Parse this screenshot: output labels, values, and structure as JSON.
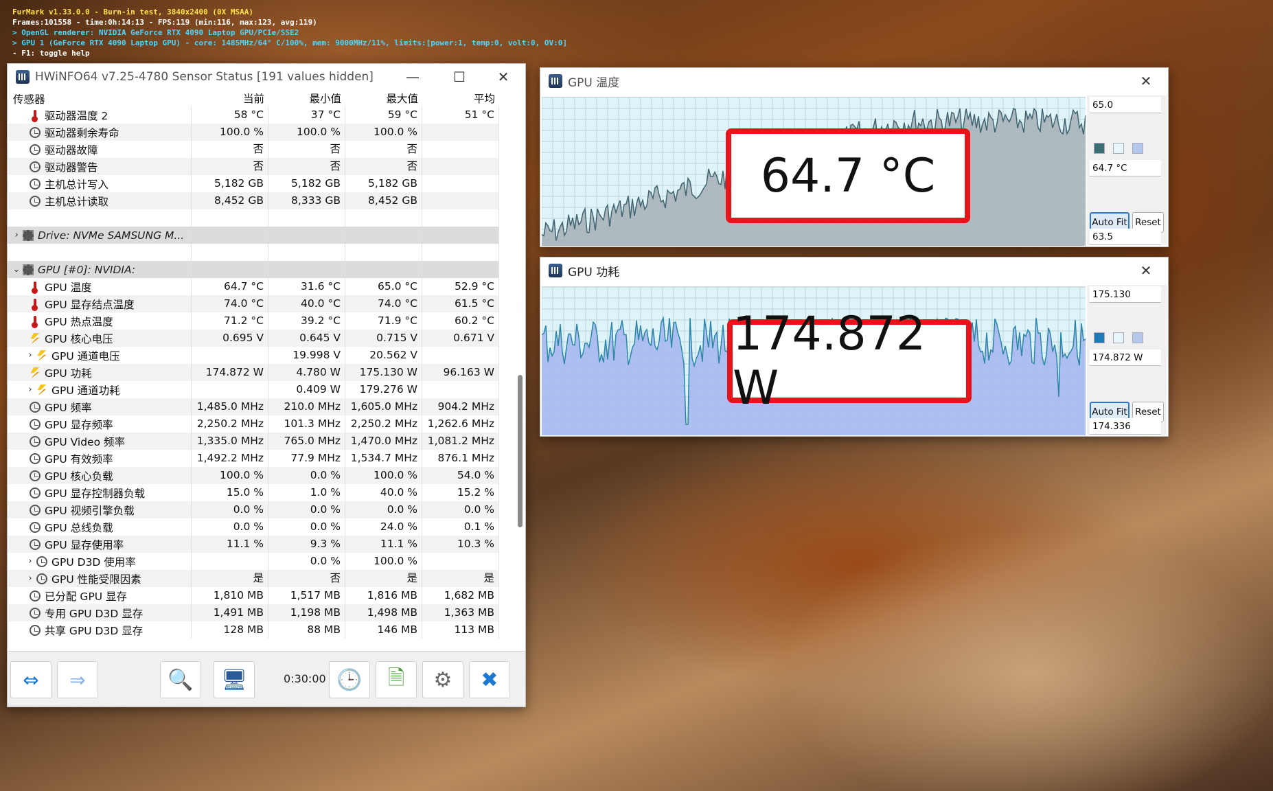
{
  "furmark": {
    "line1": "FurMark v1.33.0.0 - Burn-in test, 3840x2400 (0X MSAA)",
    "line2": "Frames:101558 - time:0h:14:13 - FPS:119 (min:116, max:123, avg:119)",
    "line3": "> OpenGL renderer: NVIDIA GeForce RTX 4090 Laptop GPU/PCIe/SSE2",
    "line4": "> GPU 1 (GeForce RTX 4090 Laptop GPU) - core: 1485MHz/64° C/100%, mem: 9000MHz/11%, limits:[power:1, temp:0, volt:0, OV:0]",
    "line5": "- F1: toggle help"
  },
  "hwinfo": {
    "title": "HWiNFO64 v7.25-4780 Sensor Status [191 values hidden]",
    "columns": [
      "传感器",
      "当前",
      "最小值",
      "最大值",
      "平均"
    ],
    "rows": [
      {
        "expander": "",
        "indent": 1,
        "icon": "thermometer-icon",
        "cells": [
          "驱动器温度 2",
          "58 °C",
          "37 °C",
          "59 °C",
          "51 °C"
        ]
      },
      {
        "expander": "",
        "indent": 1,
        "icon": "gauge-icon",
        "cells": [
          "驱动器剩余寿命",
          "100.0 %",
          "100.0 %",
          "100.0 %",
          ""
        ]
      },
      {
        "expander": "",
        "indent": 1,
        "icon": "gauge-icon",
        "cells": [
          "驱动器故障",
          "否",
          "否",
          "否",
          ""
        ]
      },
      {
        "expander": "",
        "indent": 1,
        "icon": "gauge-icon",
        "cells": [
          "驱动器警告",
          "否",
          "否",
          "否",
          ""
        ]
      },
      {
        "expander": "",
        "indent": 1,
        "icon": "gauge-icon",
        "cells": [
          "主机总计写入",
          "5,182 GB",
          "5,182 GB",
          "5,182 GB",
          ""
        ]
      },
      {
        "expander": "",
        "indent": 1,
        "icon": "gauge-icon",
        "cells": [
          "主机总计读取",
          "8,452 GB",
          "8,333 GB",
          "8,452 GB",
          ""
        ]
      },
      {
        "expander": "",
        "indent": 0,
        "icon": "",
        "cells": [
          "",
          "",
          "",
          "",
          ""
        ]
      },
      {
        "expander": "›",
        "indent": 0,
        "icon": "chip-icon",
        "group": true,
        "cells": [
          "Drive: NVMe SAMSUNG M...",
          "",
          "",
          "",
          ""
        ]
      },
      {
        "expander": "",
        "indent": 0,
        "icon": "",
        "cells": [
          "",
          "",
          "",
          "",
          ""
        ]
      },
      {
        "expander": "⌄",
        "indent": 0,
        "icon": "chip-icon",
        "group": true,
        "cells": [
          "GPU [#0]: NVIDIA:",
          "",
          "",
          "",
          ""
        ]
      },
      {
        "expander": "",
        "indent": 1,
        "icon": "thermometer-icon",
        "cells": [
          "GPU 温度",
          "64.7 °C",
          "31.6 °C",
          "65.0 °C",
          "52.9 °C"
        ]
      },
      {
        "expander": "",
        "indent": 1,
        "icon": "thermometer-icon",
        "cells": [
          "GPU 显存结点温度",
          "74.0 °C",
          "40.0 °C",
          "74.0 °C",
          "61.5 °C"
        ]
      },
      {
        "expander": "",
        "indent": 1,
        "icon": "thermometer-icon",
        "cells": [
          "GPU 热点温度",
          "71.2 °C",
          "39.2 °C",
          "71.9 °C",
          "60.2 °C"
        ]
      },
      {
        "expander": "",
        "indent": 1,
        "icon": "voltage-icon",
        "cells": [
          "GPU 核心电压",
          "0.695 V",
          "0.645 V",
          "0.715 V",
          "0.671 V"
        ]
      },
      {
        "expander": "›",
        "indent": 2,
        "icon": "voltage-icon",
        "cells": [
          "GPU 通道电压",
          "",
          "19.998 V",
          "20.562 V",
          ""
        ]
      },
      {
        "expander": "",
        "indent": 1,
        "icon": "voltage-icon",
        "cells": [
          "GPU 功耗",
          "174.872 W",
          "4.780 W",
          "175.130 W",
          "96.163 W"
        ]
      },
      {
        "expander": "›",
        "indent": 2,
        "icon": "voltage-icon",
        "cells": [
          "GPU 通道功耗",
          "",
          "0.409 W",
          "179.276 W",
          ""
        ]
      },
      {
        "expander": "",
        "indent": 1,
        "icon": "gauge-icon",
        "cells": [
          "GPU 频率",
          "1,485.0 MHz",
          "210.0 MHz",
          "1,605.0 MHz",
          "904.2 MHz"
        ]
      },
      {
        "expander": "",
        "indent": 1,
        "icon": "gauge-icon",
        "cells": [
          "GPU 显存频率",
          "2,250.2 MHz",
          "101.3 MHz",
          "2,250.2 MHz",
          "1,262.6 MHz"
        ]
      },
      {
        "expander": "",
        "indent": 1,
        "icon": "gauge-icon",
        "cells": [
          "GPU Video 频率",
          "1,335.0 MHz",
          "765.0 MHz",
          "1,470.0 MHz",
          "1,081.2 MHz"
        ]
      },
      {
        "expander": "",
        "indent": 1,
        "icon": "gauge-icon",
        "cells": [
          "GPU 有效频率",
          "1,492.2 MHz",
          "77.9 MHz",
          "1,534.7 MHz",
          "876.1 MHz"
        ]
      },
      {
        "expander": "",
        "indent": 1,
        "icon": "gauge-icon",
        "cells": [
          "GPU 核心负载",
          "100.0 %",
          "0.0 %",
          "100.0 %",
          "54.0 %"
        ]
      },
      {
        "expander": "",
        "indent": 1,
        "icon": "gauge-icon",
        "cells": [
          "GPU 显存控制器负载",
          "15.0 %",
          "1.0 %",
          "40.0 %",
          "15.2 %"
        ]
      },
      {
        "expander": "",
        "indent": 1,
        "icon": "gauge-icon",
        "cells": [
          "GPU 视频引擎负载",
          "0.0 %",
          "0.0 %",
          "0.0 %",
          "0.0 %"
        ]
      },
      {
        "expander": "",
        "indent": 1,
        "icon": "gauge-icon",
        "cells": [
          "GPU 总线负载",
          "0.0 %",
          "0.0 %",
          "24.0 %",
          "0.1 %"
        ]
      },
      {
        "expander": "",
        "indent": 1,
        "icon": "gauge-icon",
        "cells": [
          "GPU 显存使用率",
          "11.1 %",
          "9.3 %",
          "11.1 %",
          "10.3 %"
        ]
      },
      {
        "expander": "›",
        "indent": 2,
        "icon": "gauge-icon",
        "cells": [
          "GPU D3D 使用率",
          "",
          "0.0 %",
          "100.0 %",
          ""
        ]
      },
      {
        "expander": "›",
        "indent": 2,
        "icon": "gauge-icon",
        "cells": [
          "GPU 性能受限因素",
          "是",
          "否",
          "是",
          "是"
        ]
      },
      {
        "expander": "",
        "indent": 1,
        "icon": "gauge-icon",
        "cells": [
          "已分配 GPU 显存",
          "1,810 MB",
          "1,517 MB",
          "1,816 MB",
          "1,682 MB"
        ]
      },
      {
        "expander": "",
        "indent": 1,
        "icon": "gauge-icon",
        "cells": [
          "专用 GPU D3D 显存",
          "1,491 MB",
          "1,198 MB",
          "1,498 MB",
          "1,363 MB"
        ]
      },
      {
        "expander": "",
        "indent": 1,
        "icon": "gauge-icon",
        "cells": [
          "共享 GPU D3D 显存",
          "128 MB",
          "88 MB",
          "146 MB",
          "113 MB"
        ]
      }
    ],
    "scroll_position": 0.55,
    "timer": "0:30:00"
  },
  "graph_temp": {
    "title": "GPU 温度",
    "callout": "64.7 °C",
    "max_label": "65.0",
    "current_label": "64.7 °C",
    "min_label": "63.5",
    "autofit_label": "Auto Fit",
    "reset_label": "Reset",
    "colors": {
      "fill": "#a9b4b9",
      "line": "#3f6470",
      "bg": "#dff4f9",
      "swatch1": "#3b6e72",
      "swatch2": "#e6f6fb",
      "swatch3": "#b4c8ec"
    }
  },
  "graph_power": {
    "title": "GPU 功耗",
    "callout": "174.872 W",
    "max_label": "175.130",
    "current_label": "174.872 W",
    "min_label": "174.336",
    "autofit_label": "Auto Fit",
    "reset_label": "Reset",
    "colors": {
      "fill": "#a7b8f0",
      "line": "#2a86a8",
      "bg": "#dff4f9",
      "swatch1": "#1f7ab8",
      "swatch2": "#e6f6fb",
      "swatch3": "#b4c8ec"
    }
  }
}
